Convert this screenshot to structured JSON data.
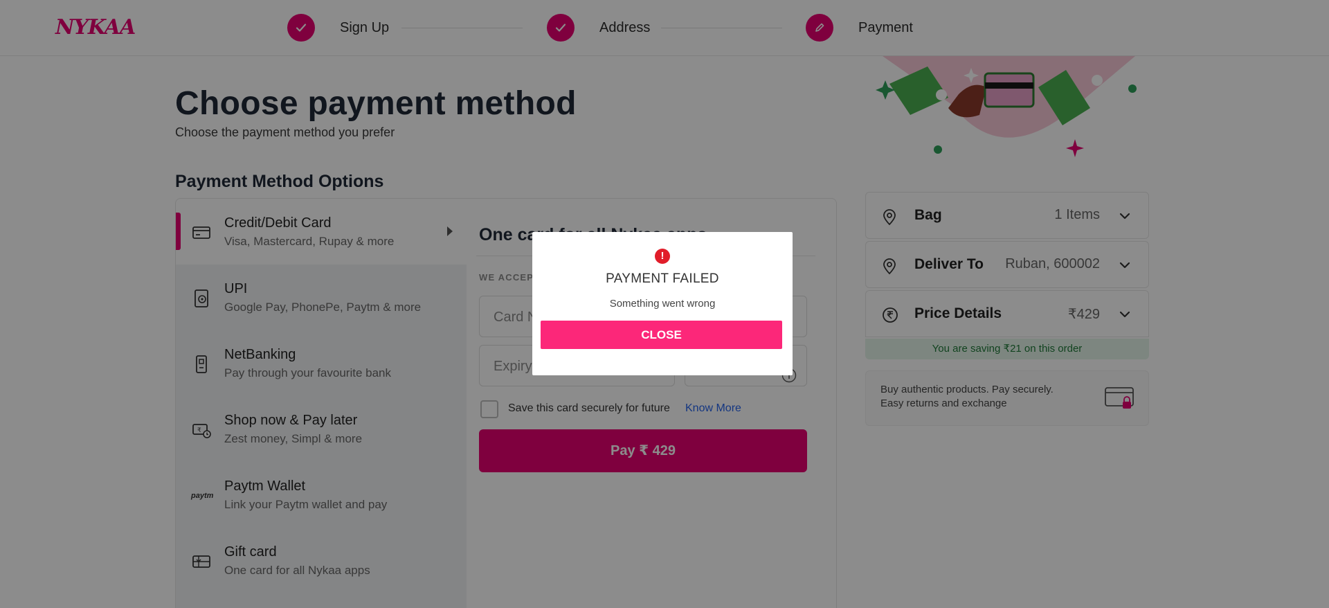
{
  "brand": {
    "logo_text": "NYKAA",
    "accent": "#e80071",
    "button_pink": "#fc2779"
  },
  "steps": [
    {
      "label": "Sign Up",
      "state": "done",
      "icon": "check-icon"
    },
    {
      "label": "Address",
      "state": "done",
      "icon": "check-icon"
    },
    {
      "label": "Payment",
      "state": "current",
      "icon": "pencil-icon"
    }
  ],
  "page": {
    "title": "Choose payment method",
    "subtitle": "Choose the payment method you prefer",
    "options_title": "Payment Method Options"
  },
  "methods": [
    {
      "title": "Credit/Debit Card",
      "desc": "Visa, Mastercard, Rupay & more",
      "icon": "card-icon",
      "active": true
    },
    {
      "title": "UPI",
      "desc": "Google Pay, PhonePe, Paytm & more",
      "icon": "upi-icon"
    },
    {
      "title": "NetBanking",
      "desc": "Pay through your favourite bank",
      "icon": "bank-icon"
    },
    {
      "title": "Shop now & Pay later",
      "desc": "Zest money, Simpl & more",
      "icon": "pay-later-icon"
    },
    {
      "title": "Paytm Wallet",
      "desc": "Link your Paytm wallet and pay",
      "icon": "paytm-icon",
      "icon_text": "paytm"
    },
    {
      "title": "Gift card",
      "desc": "One card for all Nykaa apps",
      "icon": "gift-card-icon"
    }
  ],
  "card_form": {
    "heading": "One card for all Nykaa apps",
    "accept_label": "WE ACCEPT",
    "card_number_placeholder": "Card Number",
    "expiry_placeholder": "Expiry",
    "save_label": "Save this card securely for future",
    "know_more": "Know More",
    "pay_button": "Pay ₹ 429"
  },
  "summary": {
    "bag": {
      "label": "Bag",
      "value": "1 Items"
    },
    "deliver": {
      "label": "Deliver To",
      "value": "Ruban, 600002"
    },
    "price": {
      "label": "Price Details",
      "value": "₹429"
    },
    "saving": "You are saving ₹21 on this order",
    "trust_line1": "Buy authentic products. Pay securely.",
    "trust_line2": "Easy returns and exchange"
  },
  "modal": {
    "icon": "error-icon",
    "icon_text": "!",
    "title": "PAYMENT FAILED",
    "message": "Something went wrong",
    "close": "CLOSE"
  }
}
